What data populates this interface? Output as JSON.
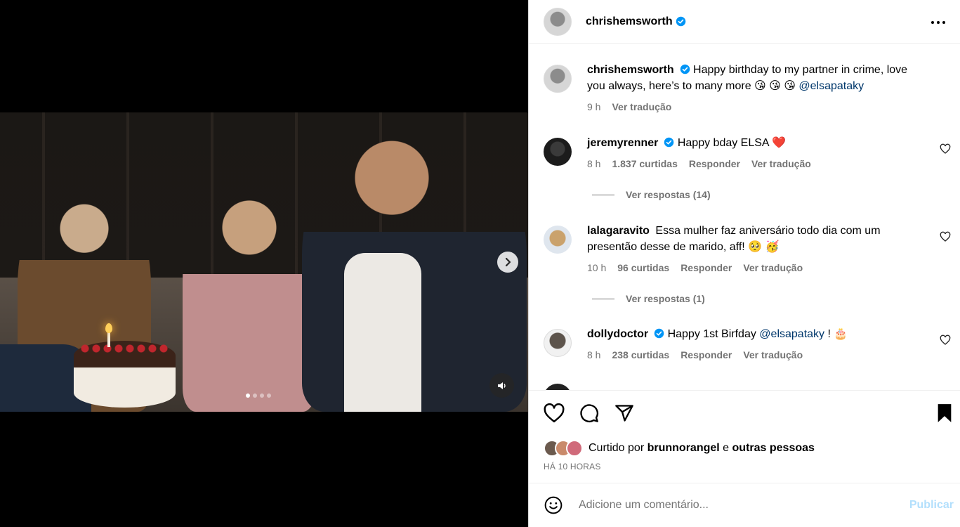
{
  "post": {
    "username": "chrishemsworth",
    "caption_author": "chrishemsworth",
    "caption_text": "Happy birthday to my partner in crime, love you always, here’s to many more 😘 😘 😘 ",
    "caption_mention": "@elsapataky",
    "caption_time": "9 h",
    "caption_translate": "Ver tradução"
  },
  "comments": [
    {
      "username": "jeremyrenner",
      "text": "Happy bday ELSA ❤️",
      "time": "8 h",
      "likes": "1.837 curtidas",
      "reply": "Responder",
      "translate": "Ver tradução",
      "replies": "Ver respostas (14)"
    },
    {
      "username": "lalagaravito",
      "text": "Essa mulher faz aniversário todo dia com um presentão desse de marido, aff! 🥺 🥳",
      "time": "10 h",
      "likes": "96 curtidas",
      "reply": "Responder",
      "translate": "Ver tradução",
      "replies": "Ver respostas (1)"
    },
    {
      "username": "dollydoctor",
      "text_before": "Happy 1st Birfday ",
      "mention": "@elsapataky",
      "text_after": " ! 🎂",
      "time": "8 h",
      "likes": "238 curtidas",
      "reply": "Responder",
      "translate": "Ver tradução"
    }
  ],
  "likes_line": {
    "prefix": "Curtido por ",
    "user": "brunnorangel",
    "middle": " e ",
    "others": "outras pessoas"
  },
  "timestamp": "HÁ 10 HORAS",
  "add_comment": {
    "placeholder": "Adicione um comentário...",
    "publish": "Publicar"
  },
  "carousel": {
    "slides": 4,
    "active": 1
  },
  "colors": {
    "verified": "#0095f6",
    "mention": "#00376b",
    "publish_disabled": "#b2dffc",
    "heart": "#ff3040"
  }
}
